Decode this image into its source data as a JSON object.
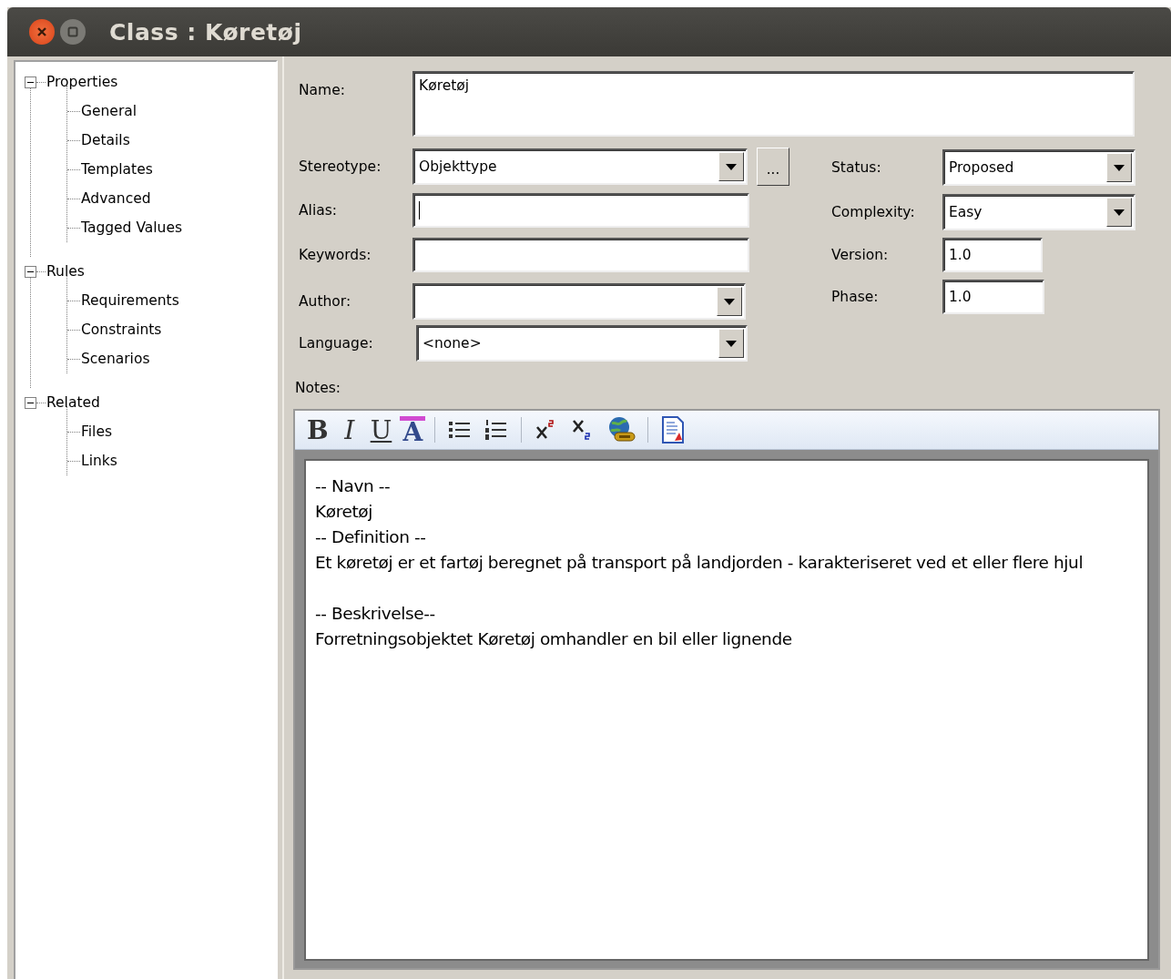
{
  "window": {
    "title": "Class : Køretøj"
  },
  "tree": [
    {
      "label": "Properties",
      "expanded": true,
      "children": [
        {
          "label": "General"
        },
        {
          "label": "Details"
        },
        {
          "label": "Templates"
        },
        {
          "label": "Advanced"
        },
        {
          "label": "Tagged Values"
        }
      ]
    },
    {
      "label": "Rules",
      "expanded": true,
      "children": [
        {
          "label": "Requirements"
        },
        {
          "label": "Constraints"
        },
        {
          "label": "Scenarios"
        }
      ]
    },
    {
      "label": "Related",
      "expanded": true,
      "children": [
        {
          "label": "Files"
        },
        {
          "label": "Links"
        }
      ]
    }
  ],
  "name_field": {
    "label": "Name:",
    "value": "Køretøj"
  },
  "left_fields": [
    {
      "kind": "combo",
      "label": "Stereotype:",
      "value": "Objekttype",
      "extra_button": "..."
    },
    {
      "kind": "text",
      "label": "Alias:",
      "focused": true
    },
    {
      "kind": "text",
      "label": "Keywords:"
    },
    {
      "kind": "combo",
      "label": "Author:"
    },
    {
      "kind": "combo",
      "label": "Language:",
      "value": "<none>"
    }
  ],
  "right_fields": [
    {
      "kind": "combo",
      "label": "Status:",
      "value": "Proposed"
    },
    {
      "kind": "combo",
      "label": "Complexity:",
      "value": "Easy"
    },
    {
      "kind": "text",
      "label": "Version:",
      "value": "1.0"
    },
    {
      "kind": "text",
      "label": "Phase:",
      "value": "1.0"
    }
  ],
  "notes": {
    "label": "Notes:",
    "toolbar": [
      {
        "kind": "bold",
        "label": "B"
      },
      {
        "kind": "italic",
        "label": "I"
      },
      {
        "kind": "underline",
        "label": "U"
      },
      {
        "kind": "font-color",
        "label": "A"
      },
      {
        "kind": "separator"
      },
      {
        "kind": "bullets"
      },
      {
        "kind": "numbering"
      },
      {
        "kind": "separator"
      },
      {
        "kind": "superscript"
      },
      {
        "kind": "subscript"
      },
      {
        "kind": "hyperlink"
      },
      {
        "kind": "separator"
      },
      {
        "kind": "document"
      }
    ],
    "paragraphs": [
      [
        "-- Navn --",
        "Køretøj",
        "-- Definition --",
        "Et køretøj er et fartøj beregnet på transport på landjorden - karakteriseret ved et eller flere hjul"
      ],
      [
        "-- Beskrivelse--",
        "Forretningsobjektet Køretøj omhandler en bil eller lignende"
      ]
    ]
  }
}
